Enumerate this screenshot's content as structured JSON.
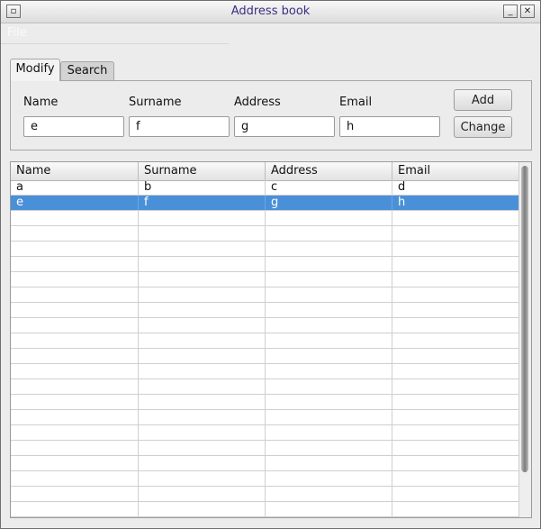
{
  "window": {
    "title": "Address book"
  },
  "menu": {
    "file": "File"
  },
  "tabs": [
    {
      "label": "Modify"
    },
    {
      "label": "Search"
    }
  ],
  "form": {
    "labels": {
      "name": "Name",
      "surname": "Surname",
      "address": "Address",
      "email": "Email"
    },
    "values": {
      "name": "e",
      "surname": "f",
      "address": "g",
      "email": "h"
    },
    "add_label": "Add",
    "change_label": "Change"
  },
  "table": {
    "columns": [
      "Name",
      "Surname",
      "Address",
      "Email"
    ],
    "rows": [
      {
        "name": "a",
        "surname": "b",
        "address": "c",
        "email": "d",
        "selected": false
      },
      {
        "name": "e",
        "surname": "f",
        "address": "g",
        "email": "h",
        "selected": true
      }
    ]
  },
  "colors": {
    "selection": "#4a90d9",
    "title_text": "#3a2f83"
  }
}
